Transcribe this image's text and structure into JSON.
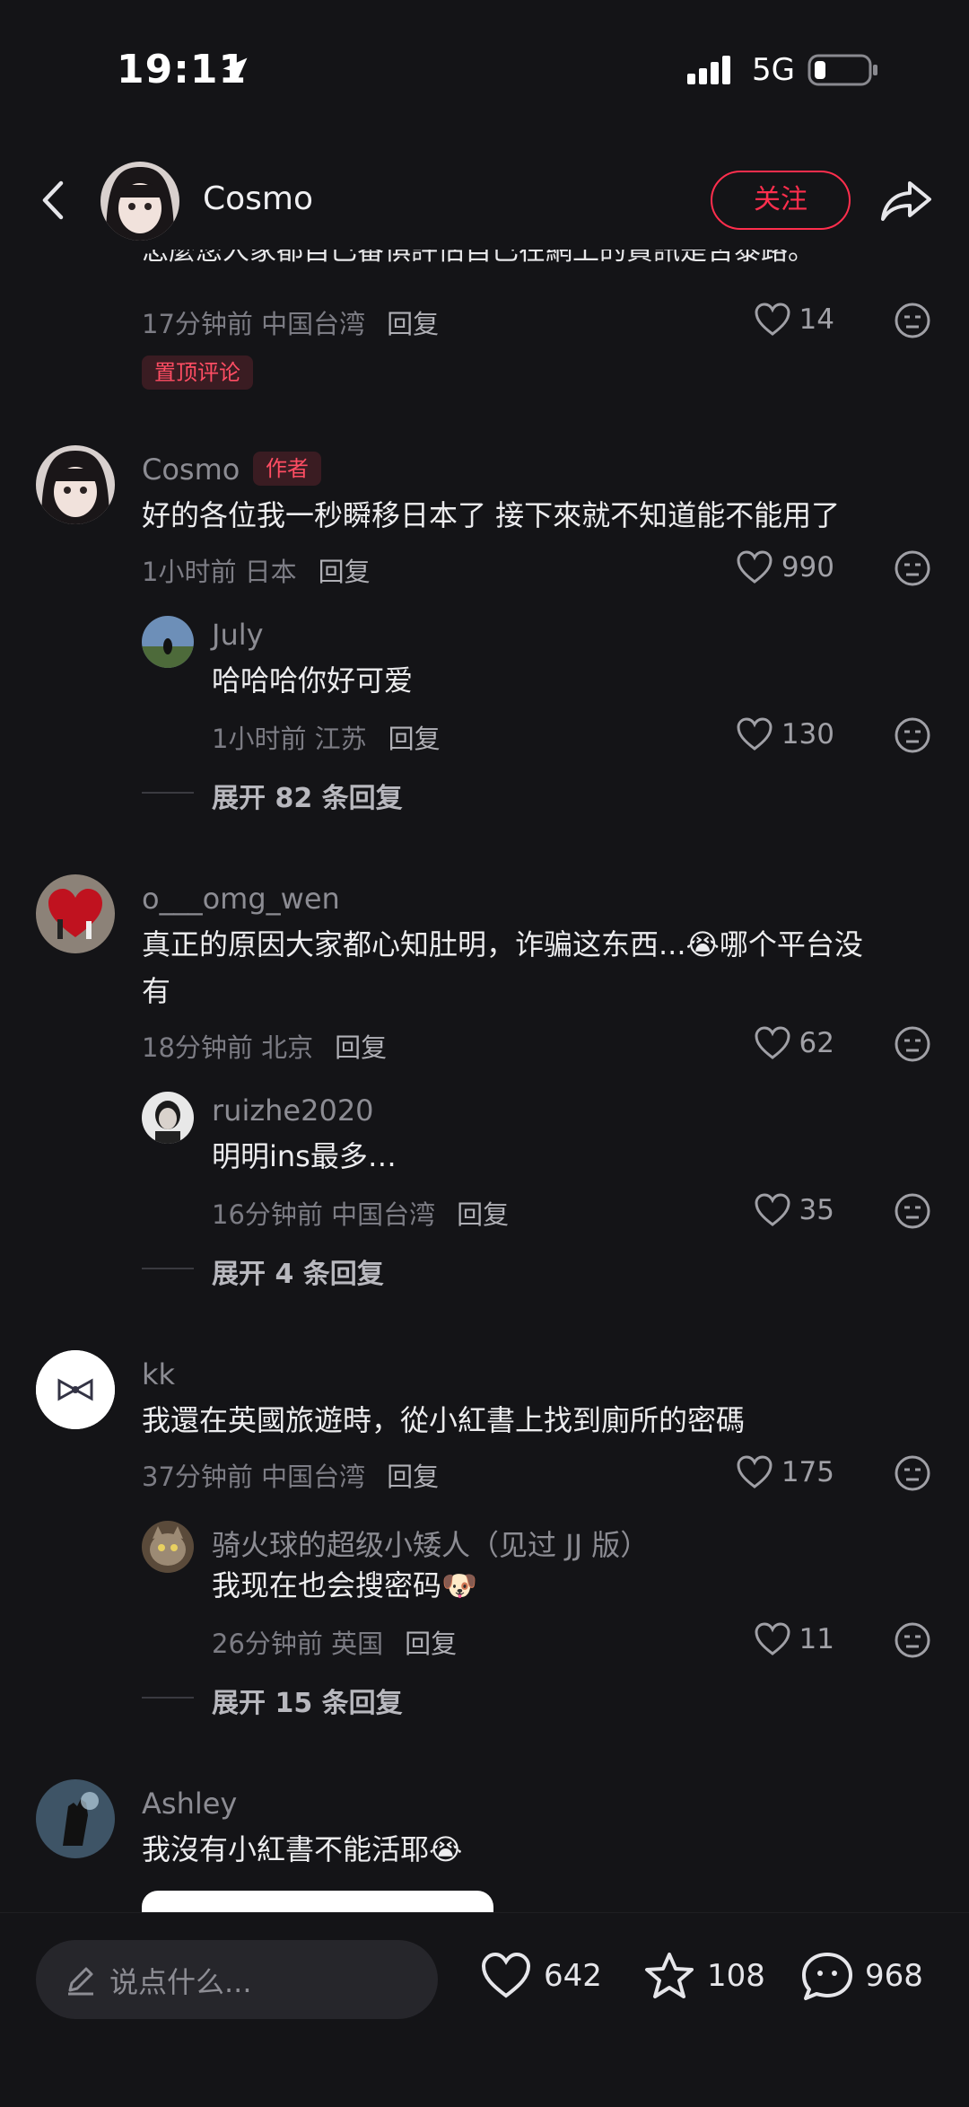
{
  "status_bar": {
    "time": "19:11",
    "network": "5G"
  },
  "header": {
    "username": "Cosmo",
    "follow_label": "关注"
  },
  "partial_comment": {
    "text": "怎麼您人家都自已番惧評估自已在網上的資訊是否泰路。",
    "meta": "17分钟前 中国台湾",
    "reply": "回复",
    "likes": "14",
    "badge": "置顶评论"
  },
  "comments": [
    {
      "username": "Cosmo",
      "badge": "作者",
      "text": "好的各位我一秒瞬移日本了 接下來就不知道能不能用了",
      "meta": "1小时前 日本",
      "reply": "回复",
      "likes": "990",
      "sub": {
        "username": "July",
        "text": "哈哈哈你好可爱",
        "meta": "1小时前 江苏",
        "reply": "回复",
        "likes": "130"
      },
      "expand": "展开 82 条回复"
    },
    {
      "username": "o___omg_wen",
      "text_line1": "真正的原因大家都心知肚明，诈骗这东西...",
      "emoji": "😭",
      "text_line1_rest": "哪个平台没",
      "text_line2": "有",
      "meta": "18分钟前 北京",
      "reply": "回复",
      "likes": "62",
      "sub": {
        "username": "ruizhe2020",
        "text": "明明ins最多…",
        "meta": "16分钟前 中国台湾",
        "reply": "回复",
        "likes": "35"
      },
      "expand": "展开 4 条回复"
    },
    {
      "username": "kk",
      "text": "我還在英國旅遊時，從小紅書上找到廁所的密碼",
      "meta": "37分钟前 中国台湾",
      "reply": "回复",
      "likes": "175",
      "sub": {
        "username": "骑火球的超级小矮人（见过 JJ 版）",
        "text": "我现在也会搜密码",
        "emoji": "🐶",
        "meta": "26分钟前 英国",
        "reply": "回复",
        "likes": "11"
      },
      "expand": "展开 15 条回复"
    },
    {
      "username": "Ashley",
      "text": "我沒有小紅書不能活耶",
      "emoji": "😭"
    }
  ],
  "bottom_bar": {
    "input_placeholder": "说点什么...",
    "likes": "642",
    "stars": "108",
    "comments": "968"
  },
  "colors": {
    "accent": "#ff2e4d",
    "background": "#141417"
  }
}
